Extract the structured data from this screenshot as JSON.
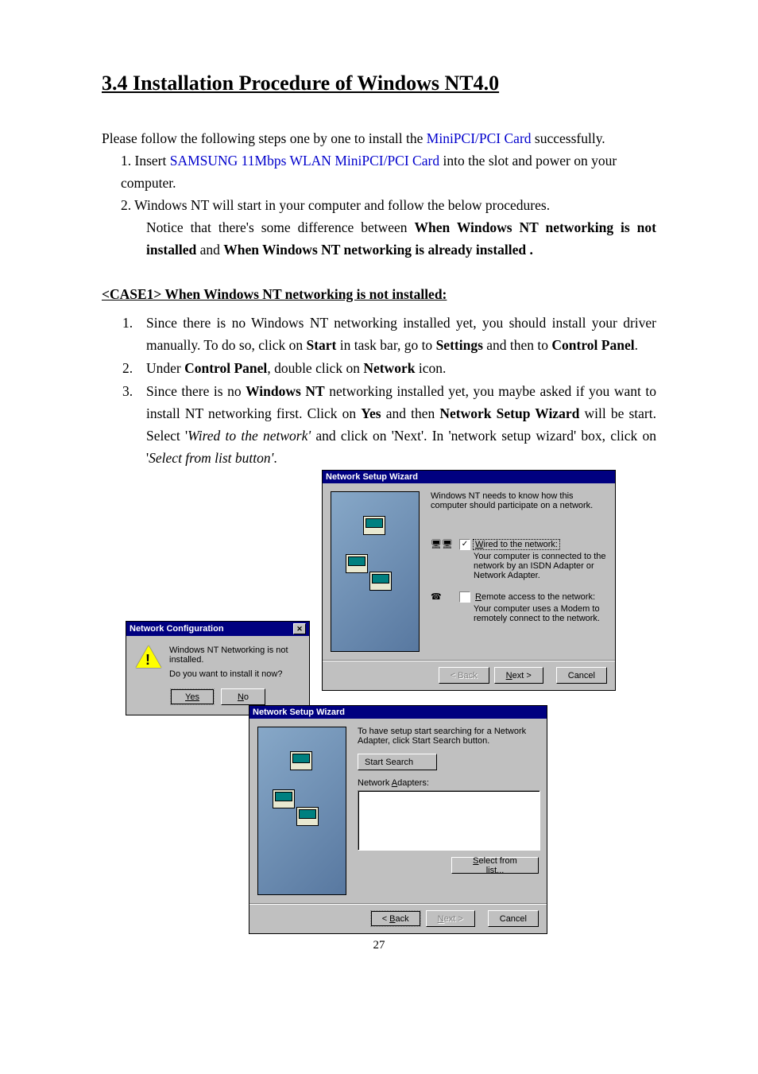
{
  "section_title": "3.4 Installation Procedure of Windows NT4.0",
  "intro_prefix": "Please follow the following steps one by one to install the ",
  "intro_link": "MiniPCI/PCI Card",
  "intro_suffix": " successfully.",
  "step1_prefix": "1. Insert ",
  "step1_product": "SAMSUNG 11Mbps WLAN MiniPCI/PCI Card",
  "step1_suffix": " into the slot and power on your computer.",
  "step2": "2. Windows NT will start in your computer and  follow the below procedures.",
  "notice_prefix": "Notice that there's some difference between ",
  "notice_bold1": "When Windows NT networking is not installed",
  "notice_mid": " and ",
  "notice_bold2": "When Windows NT networking is already installed .",
  "case1_heading": "<CASE1> When Windows NT networking is not installed:",
  "c1_1_pre": "Since there is no Windows NT networking installed yet, you should install your driver manually. To do so, click on ",
  "c1_1_b1": "Start",
  "c1_1_mid": " in task bar, go to ",
  "c1_1_b2": "Settings",
  "c1_1_mid2": " and then to ",
  "c1_1_b3": "Control Panel",
  "c1_1_end": ".",
  "c1_2_pre": "Under ",
  "c1_2_b1": "Control Panel",
  "c1_2_mid": ", double click on ",
  "c1_2_b2": "Network",
  "c1_2_end": " icon.",
  "c1_3_pre": "Since there is no ",
  "c1_3_b1": "Windows NT",
  "c1_3_mid": " networking installed yet, you maybe asked if you want to install NT networking first. Click on ",
  "c1_3_b2": "Yes",
  "c1_3_mid2": " and then ",
  "c1_3_b3": "Network Setup Wizard",
  "c1_3_mid3": " will be start. Select '",
  "c1_3_i1": "Wired to the network'",
  "c1_3_mid4": " and click on 'Next'. In 'network setup wizard' box, click on '",
  "c1_3_i2": "Select from list button'",
  "c1_3_end": ".",
  "dialog1": {
    "title": "Network Configuration",
    "line1": "Windows NT Networking is not installed.",
    "line2": "Do you want to install it now?",
    "yes": "Yes",
    "no": "No"
  },
  "dialog2": {
    "title": "Network Setup Wizard",
    "intro": "Windows NT needs to know how this computer should participate on a network.",
    "opt1_label": "Wired to the network:",
    "opt1_desc": "Your computer is connected to the network by an ISDN Adapter or Network Adapter.",
    "opt2_label": "Remote access to the network:",
    "opt2_desc": "Your computer uses a Modem to remotely connect to the network.",
    "back": "< Back",
    "next": "Next >",
    "cancel": "Cancel"
  },
  "dialog3": {
    "title": "Network Setup Wizard",
    "intro": "To have setup start searching for a Network Adapter, click Start Search button.",
    "start_search": "Start Search",
    "list_label": "Network Adapters:",
    "select_list": "Select from list...",
    "back": "< Back",
    "next": "Next >",
    "cancel": "Cancel"
  },
  "page_number": "27"
}
